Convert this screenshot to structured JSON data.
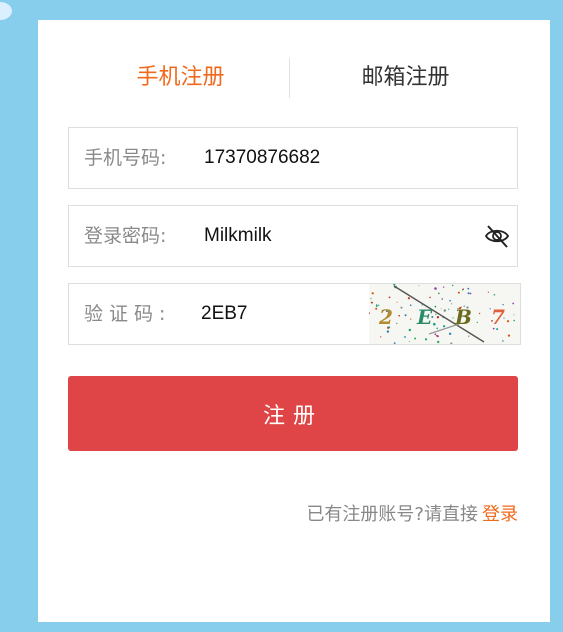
{
  "tabs": {
    "phone": "手机注册",
    "email": "邮箱注册"
  },
  "form": {
    "phone": {
      "label": "手机号码:",
      "value": "17370876682"
    },
    "password": {
      "label": "登录密码:",
      "value": "Milkmilk"
    },
    "captcha": {
      "label": "验证码:",
      "value": "2EB7",
      "chars": [
        "2",
        "E",
        "B",
        "7"
      ],
      "char_colors": [
        "#b08a30",
        "#2a8a6a",
        "#6b6b20",
        "#e0603a"
      ]
    },
    "submit_label": "注册"
  },
  "footer": {
    "prompt": "已有注册账号?请直接",
    "login_link": "登录"
  },
  "icons": {
    "password_toggle": "eye-off-icon"
  },
  "colors": {
    "background": "#87ceec",
    "accent": "#f06a1d",
    "submit": "#df4446"
  }
}
